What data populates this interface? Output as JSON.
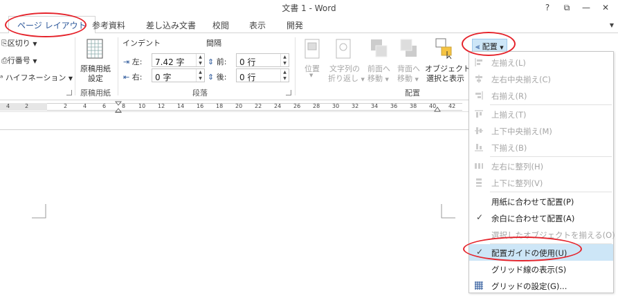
{
  "window": {
    "title": "文書 1 - Word",
    "help": "?",
    "restore": "⧉",
    "minimize": "—",
    "close": "✕"
  },
  "tabs": [
    {
      "label": "ページ レイアウト",
      "active": true
    },
    {
      "label": "参考資料"
    },
    {
      "label": "差し込み文書"
    },
    {
      "label": "校閲"
    },
    {
      "label": "表示"
    },
    {
      "label": "開発"
    }
  ],
  "ribbon": {
    "page_setup": {
      "breaks": "区切り",
      "line_numbers": "行番号",
      "hyphenation": "ハイフネーション"
    },
    "genko": {
      "btn_line1": "原稿用紙",
      "btn_line2": "設定",
      "group": "原稿用紙"
    },
    "paragraph": {
      "indent_label": "インデント",
      "spacing_label": "間隔",
      "left_label": "左:",
      "left_value": "7.42 字",
      "right_label": "右:",
      "right_value": "0 字",
      "before_label": "前:",
      "before_value": "0 行",
      "after_label": "後:",
      "after_value": "0 行",
      "group": "段落"
    },
    "arrange": {
      "position": "位置",
      "wrap_line1": "文字列の",
      "wrap_line2": "折り返し",
      "front_line1": "前面へ",
      "front_line2": "移動",
      "back_line1": "背面へ",
      "back_line2": "移動",
      "select_line1": "オブジェクトの",
      "select_line2": "選択と表示",
      "align_button": "配置",
      "group": "配置"
    }
  },
  "ruler": {
    "ticks": [
      "4",
      "2",
      "2",
      "4",
      "6",
      "8",
      "10",
      "12",
      "14",
      "16",
      "18",
      "20",
      "22",
      "24",
      "26",
      "28",
      "30",
      "32",
      "34",
      "36",
      "38",
      "40",
      "42"
    ]
  },
  "menu": {
    "items": [
      {
        "label": "左揃え(L)",
        "disabled": true
      },
      {
        "label": "左右中央揃え(C)",
        "disabled": true
      },
      {
        "label": "右揃え(R)",
        "disabled": true
      },
      {
        "label": "上揃え(T)",
        "disabled": true
      },
      {
        "label": "上下中央揃え(M)",
        "disabled": true
      },
      {
        "label": "下揃え(B)",
        "disabled": true
      },
      {
        "label": "左右に整列(H)",
        "disabled": true
      },
      {
        "label": "上下に整列(V)",
        "disabled": true
      },
      {
        "label": "用紙に合わせて配置(P)",
        "disabled": false
      },
      {
        "label": "余白に合わせて配置(A)",
        "disabled": false,
        "checked": true
      },
      {
        "label": "選択したオブジェクトを揃える(O)",
        "disabled": true
      },
      {
        "label": "配置ガイドの使用(U)",
        "disabled": false,
        "checked": true,
        "highlighted": true
      },
      {
        "label": "グリッド線の表示(S)",
        "disabled": false
      },
      {
        "label": "グリッドの設定(G)...",
        "disabled": false
      }
    ],
    "check_mark": "✓"
  },
  "colors": {
    "accent": "#2b579a",
    "highlight": "#cde6f7",
    "annotation": "#e5232b",
    "disabled": "#a6a6a6"
  }
}
